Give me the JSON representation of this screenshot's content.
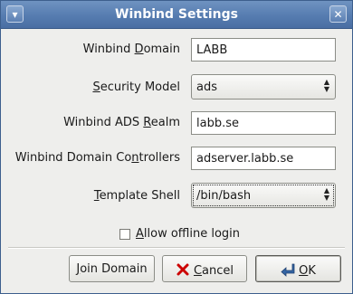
{
  "window": {
    "title": "Winbind Settings"
  },
  "form": {
    "domain": {
      "label_pre": "Winbind ",
      "label_u": "D",
      "label_post": "omain",
      "value": "LABB"
    },
    "security_model": {
      "label_pre": "",
      "label_u": "S",
      "label_post": "ecurity Model",
      "value": "ads"
    },
    "ads_realm": {
      "label_pre": "Winbind ADS ",
      "label_u": "R",
      "label_post": "ealm",
      "value": "labb.se"
    },
    "controllers": {
      "label_pre": "Winbind Domain Co",
      "label_u": "n",
      "label_post": "trollers",
      "value": "adserver.labb.se"
    },
    "template_shell": {
      "label_pre": "",
      "label_u": "T",
      "label_post": "emplate Shell",
      "value": "/bin/bash"
    },
    "offline_login": {
      "label_u": "A",
      "label_post": "llow offline login",
      "checked": false
    }
  },
  "buttons": {
    "join": {
      "label_u": "J",
      "label_post": "oin Domain"
    },
    "cancel": {
      "label_u": "C",
      "label_post": "ancel",
      "icon": "cancel-icon",
      "icon_color": "#cc0000"
    },
    "ok": {
      "label_u": "O",
      "label_post": "K",
      "icon": "ok-arrow-icon",
      "icon_color": "#3465a4"
    }
  },
  "colors": {
    "titlebar": "#567cb0",
    "background": "#eeeeec"
  }
}
